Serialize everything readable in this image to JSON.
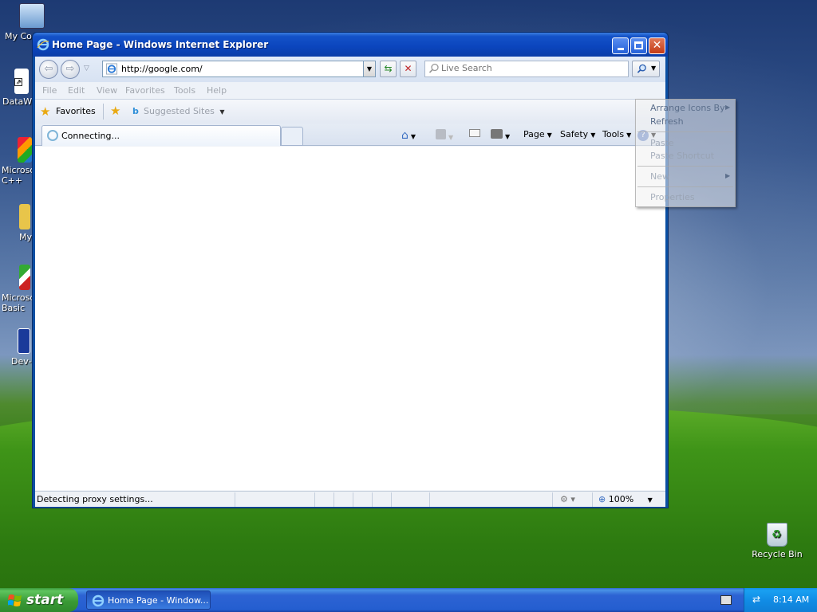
{
  "desktop": {
    "icons": [
      {
        "label": "My Com"
      },
      {
        "label": "DataWa"
      },
      {
        "label": "Microso C++"
      },
      {
        "label": "My"
      },
      {
        "label": "Microso Basic"
      },
      {
        "label": "Dev-"
      }
    ],
    "recycle_bin": {
      "label": "Recycle Bin"
    }
  },
  "window": {
    "title": "Home Page - Windows Internet Explorer",
    "address": "http://google.com/",
    "search_placeholder": "Live Search",
    "menu": [
      "File",
      "Edit",
      "View",
      "Favorites",
      "Tools",
      "Help"
    ],
    "favorites_label": "Favorites",
    "suggested_sites_label": "Suggested Sites",
    "tab_label": "Connecting...",
    "commands": {
      "page": "Page",
      "safety": "Safety",
      "tools": "Tools"
    },
    "status_text": "Detecting proxy settings...",
    "zoom": "100%"
  },
  "context_menu": {
    "items": [
      {
        "label": "Arrange Icons By",
        "enabled": true,
        "submenu": true
      },
      {
        "label": "Refresh",
        "enabled": true
      },
      {
        "label": "Paste",
        "enabled": false
      },
      {
        "label": "Paste Shortcut",
        "enabled": false
      },
      {
        "label": "New",
        "enabled": false,
        "submenu": true
      },
      {
        "label": "Properties",
        "enabled": false
      }
    ]
  },
  "taskbar": {
    "start_label": "start",
    "task_item_label": "Home Page - Window...",
    "clock": "8:14 AM"
  },
  "icons": {
    "ie": "internet-explorer-icon",
    "favorites": "star-icon",
    "search": "magnifier-icon"
  },
  "colors": {
    "titlebar": "#0b45bd",
    "taskbar": "#245ed0",
    "start": "#3a9a36"
  }
}
